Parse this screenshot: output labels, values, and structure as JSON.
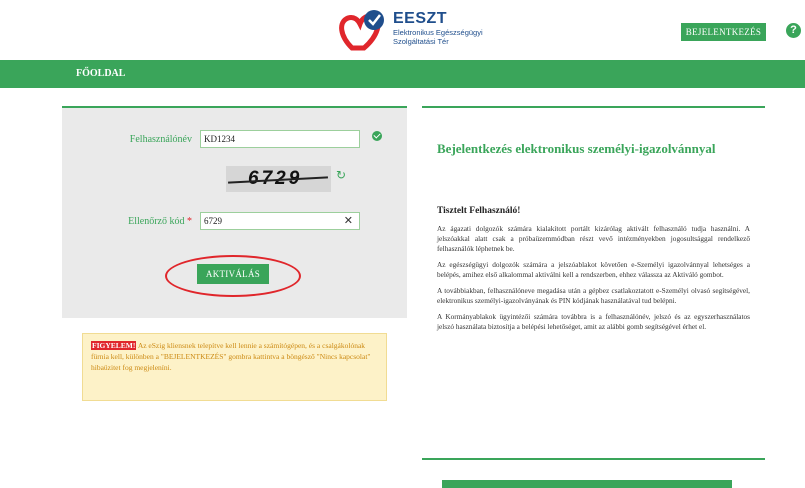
{
  "header": {
    "logo_title": "EESZT",
    "logo_subtitle": "Elektronikus Egészségügyi Szolgáltatási Tér",
    "login_button": "BEJELENTKEZÉS",
    "help_icon": "?"
  },
  "nav": {
    "home": "FŐOLDAL"
  },
  "login": {
    "username_label": "Felhasználónév",
    "username_value": "KD1234",
    "captcha_text": "6729",
    "verify_label": "Ellenőrző kód",
    "required_mark": "*",
    "verify_value": "6729",
    "activate_button": "AKTIVÁLÁS"
  },
  "warning": {
    "tag": "FIGYELEM!",
    "text": "Az eSzig kliensnek telepítve kell lennie a számítógépen, és a csalgákolónak fürnia kell, különben a \"BEJELENTKEZÉS\" gombra kattintva a böngésző \"Nincs kapcsolat\" hibaüzitet fog megjeleníni."
  },
  "info": {
    "title": "Bejelentkezés elektronikus személyi-igazolvánnyal",
    "greeting": "Tisztelt Felhasználó!",
    "paragraphs": [
      "Az ágazati dolgozók számára kialakított portált kizárólag aktivált felhasználó tudja használni. A jelszóakkal alatt csak a próbaüzemmódban részt vevő intézményekben jogosultsággal rendelkező felhasználók léphetnek be.",
      "Az egészségügyi dolgozók számára a jelszóablakot követően e-Személyi igazolvánnyal lehetséges a belépés, amihez első alkalommal aktiválni kell a rendszerben, ehhez válassza az Aktiváló gombot.",
      "A továbbiakban, felhasználóneve megadása után a gépbez csatlakoztatott e-Személyi olvasó segítségével, elektronikus személyi-igazolványának és PIN kódjának használatával tud belépni.",
      "A Kormányablakok ügyintézői számára továbbra is a felhasználónév, jelszó és az egyszerhasználatos jelszó használata biztosítja a belépési lehetőséget, amit az alábbi gomb segítségével érhet el."
    ]
  }
}
